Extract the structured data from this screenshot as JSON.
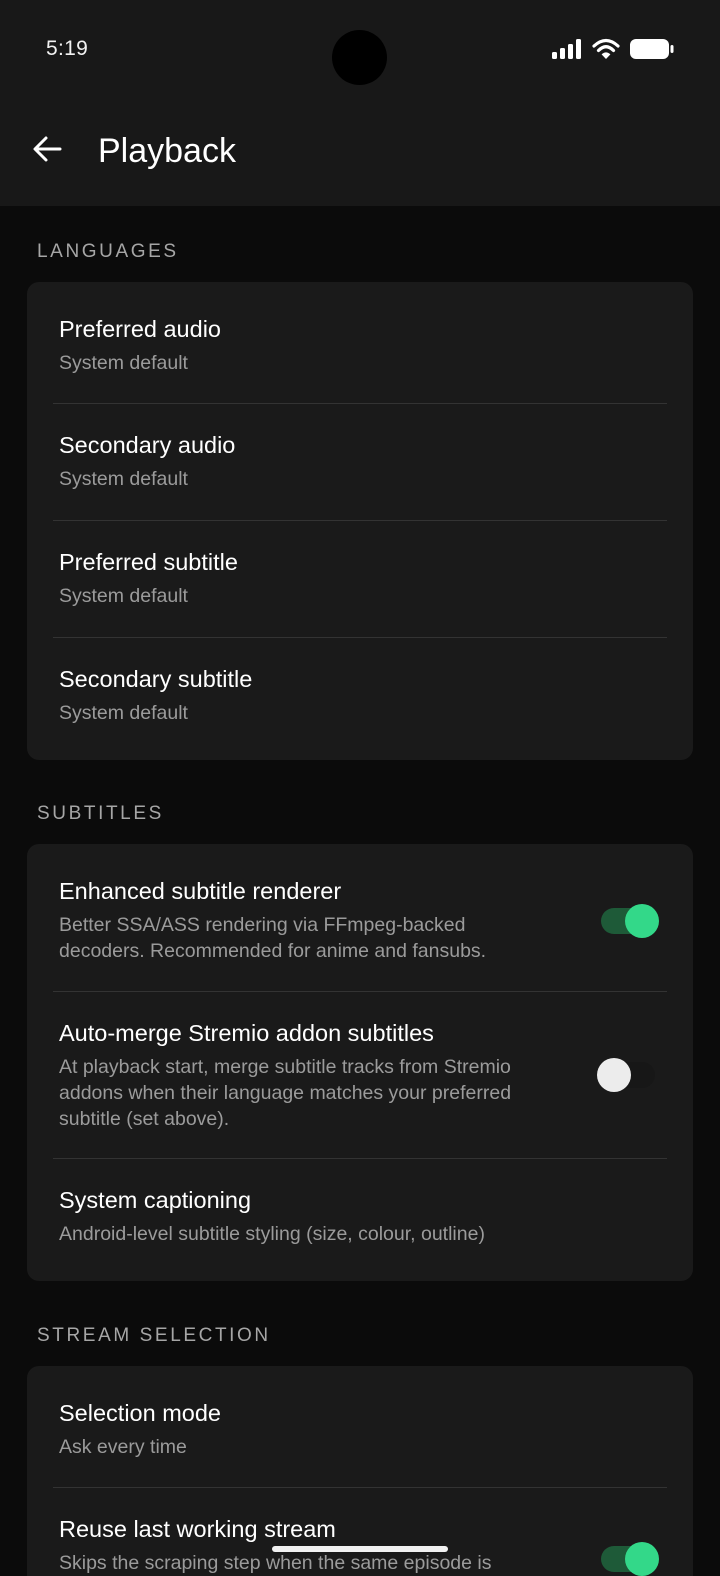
{
  "status_bar": {
    "time": "5:19"
  },
  "app_bar": {
    "title": "Playback"
  },
  "sections": {
    "languages": {
      "header": "LANGUAGES",
      "items": [
        {
          "title": "Preferred audio",
          "subtitle": "System default"
        },
        {
          "title": "Secondary audio",
          "subtitle": "System default"
        },
        {
          "title": "Preferred subtitle",
          "subtitle": "System default"
        },
        {
          "title": "Secondary subtitle",
          "subtitle": "System default"
        }
      ]
    },
    "subtitles": {
      "header": "SUBTITLES",
      "items": [
        {
          "title": "Enhanced subtitle renderer",
          "subtitle_line1": "Better SSA/ASS rendering via FFmpeg-backed",
          "subtitle_line2": "decoders. Recommended for anime and fansubs.",
          "toggle": "on"
        },
        {
          "title": "Auto-merge Stremio addon subtitles",
          "subtitle_line1": "At playback start, merge subtitle tracks from Stremio",
          "subtitle_line2": "addons when their language matches your preferred",
          "subtitle_line3": "subtitle (set above).",
          "toggle": "off"
        },
        {
          "title": "System captioning",
          "subtitle": "Android-level subtitle styling (size, colour, outline)"
        }
      ]
    },
    "stream_selection": {
      "header": "STREAM SELECTION",
      "items": [
        {
          "title": "Selection mode",
          "subtitle": "Ask every time"
        },
        {
          "title": "Reuse last working stream",
          "subtitle": "Skips the scraping step when the same episode is",
          "toggle": "on"
        }
      ]
    }
  },
  "colors": {
    "accent": "#33d889",
    "accent_track": "#1e5a38",
    "card": "#1a1a1a",
    "background": "#0b0b0b",
    "surface": "#181818"
  },
  "icons": {
    "back": "arrow-left-icon",
    "signal": "cellular-signal-icon",
    "wifi": "wifi-icon",
    "battery": "battery-icon"
  }
}
